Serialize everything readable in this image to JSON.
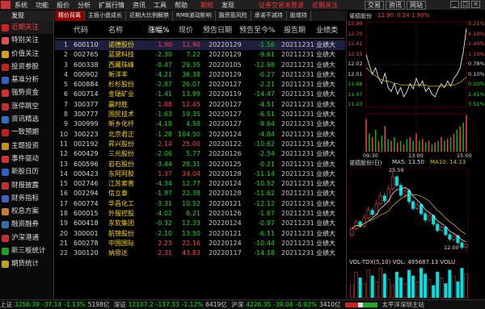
{
  "menu": {
    "items": [
      "系统",
      "功能",
      "报价",
      "分析",
      "扩展行情",
      "资讯",
      "工具",
      "帮助"
    ],
    "period_label": "期权",
    "find_label": "发现",
    "broker_text": "证券交易未登录",
    "follow_text": "近期关注",
    "btn_trade": "交易",
    "btn_info": "资讯",
    "btn_bbs": "网站"
  },
  "window_controls": [
    "_",
    "□",
    "×"
  ],
  "sidebar": {
    "title": "发现",
    "items": [
      {
        "label": "近期关注",
        "color": "#d02020",
        "active": true
      },
      {
        "label": "特别关注",
        "color": "#e05050"
      },
      {
        "label": "价值关注",
        "color": "#d8a020"
      },
      {
        "label": "投资参股",
        "color": "#c02020"
      },
      {
        "label": "基准分析",
        "color": "#3060c0"
      },
      {
        "label": "强势资金",
        "color": "#d03030"
      },
      {
        "label": "涨停跳空",
        "color": "#c03030"
      },
      {
        "label": "资讯精选",
        "color": "#3070c0"
      },
      {
        "label": "一致预期",
        "color": "#c02020"
      },
      {
        "label": "主题投资",
        "color": "#c09020"
      },
      {
        "label": "事件驱动",
        "color": "#d03030"
      },
      {
        "label": "新股日历",
        "color": "#3060c0"
      },
      {
        "label": "财报披露",
        "color": "#c03030"
      },
      {
        "label": "财务指标",
        "color": "#4060c0"
      },
      {
        "label": "权息方案",
        "color": "#c08030"
      },
      {
        "label": "融资融券",
        "color": "#3070b0"
      },
      {
        "label": "沪深港通",
        "color": "#c03030"
      },
      {
        "label": "新三板统计",
        "color": "#20a020"
      },
      {
        "label": "期货统计",
        "color": "#c0a020"
      }
    ]
  },
  "tabs": [
    "精价背离",
    "主板小盘成长",
    "近期大比例解禁",
    "RMB波动影响",
    "融资盈风险",
    "承诺不减持",
    "股增持"
  ],
  "table": {
    "headers": [
      "代码",
      "名称",
      "涨幅%",
      "现价",
      "预告日期",
      "预告至今%",
      "报告期",
      "业绩类"
    ],
    "rows": [
      {
        "idx": "1",
        "code": "600110",
        "name": "诺德股份",
        "pct": "1.90",
        "price": "12.90",
        "date": "20220129",
        "to": "-1.56",
        "report": "20211231",
        "type": "业绩大"
      },
      {
        "idx": "2",
        "code": "002765",
        "name": "蓝黛科技",
        "pct": "-2.30",
        "price": "7.22",
        "date": "20220129",
        "to": "-9.61",
        "report": "20211231",
        "type": "业绩大"
      },
      {
        "idx": "3",
        "code": "600338",
        "name": "西藏珠峰",
        "pct": "-0.47",
        "price": "29.35",
        "date": "20220105",
        "to": "-12.98",
        "report": "20211231",
        "type": "业绩大"
      },
      {
        "idx": "4",
        "code": "000902",
        "name": "新洋丰",
        "pct": "-4.21",
        "price": "36.38",
        "date": "20220129",
        "to": "-0.27",
        "report": "20211231",
        "type": "业绩大"
      },
      {
        "idx": "5",
        "code": "600884",
        "name": "杉杉股份",
        "pct": "-2.87",
        "price": "26.07",
        "date": "20220127",
        "to": "-2.21",
        "report": "20211231",
        "type": "业绩大"
      },
      {
        "idx": "6",
        "code": "600714",
        "name": "金瑞矿业",
        "pct": "-1.41",
        "price": "13.99",
        "date": "20220119",
        "to": "-14.47",
        "report": "20211231",
        "type": "业绩大"
      },
      {
        "idx": "7",
        "code": "300377",
        "name": "赢时胜",
        "pct": "1.88",
        "price": "12.45",
        "date": "20220127",
        "to": "-4.51",
        "report": "20211231",
        "type": "业绩大"
      },
      {
        "idx": "8",
        "code": "300777",
        "name": "国民技术",
        "pct": "-1.63",
        "price": "19.35",
        "date": "20220127",
        "to": "-6.51",
        "report": "20211231",
        "type": "业绩大"
      },
      {
        "idx": "9",
        "code": "300999",
        "name": "新乡化纤",
        "pct": "-4.18",
        "price": "4.58",
        "date": "20220127",
        "to": "-9.64",
        "report": "20211231",
        "type": "业绩大"
      },
      {
        "idx": "10",
        "code": "300223",
        "name": "北京君正",
        "pct": "-1.28",
        "price": "104.50",
        "date": "20220124",
        "to": "-4.84",
        "report": "20211231",
        "type": "业绩大"
      },
      {
        "idx": "11",
        "code": "002192",
        "name": "昇兴股份",
        "pct": "2.14",
        "price": "25.00",
        "date": "20220122",
        "to": "-10.62",
        "report": "20211231",
        "type": "业绩大"
      },
      {
        "idx": "12",
        "code": "600429",
        "name": "三元股份",
        "pct": "-2.06",
        "price": "5.77",
        "date": "20220126",
        "to": "-2.54",
        "report": "20211231",
        "type": "业绩大"
      },
      {
        "idx": "13",
        "code": "600596",
        "name": "岩石股份",
        "pct": "-3.44",
        "price": "28.31",
        "date": "20220125",
        "to": "-0.21",
        "report": "20211231",
        "type": "业绩大"
      },
      {
        "idx": "14",
        "code": "000423",
        "name": "东阿阿胶",
        "pct": "1.37",
        "price": "34.04",
        "date": "20220128",
        "to": "-11.14",
        "report": "20211231",
        "type": "业绩大"
      },
      {
        "idx": "15",
        "code": "002746",
        "name": "江苏索普",
        "pct": "-4.34",
        "price": "12.77",
        "date": "20220124",
        "to": "-10.52",
        "report": "20211231",
        "type": "业绩大"
      },
      {
        "idx": "16",
        "code": "002294",
        "name": "信立泰",
        "pct": "-1.97",
        "price": "22.38",
        "date": "20220128",
        "to": "-11.62",
        "report": "20211231",
        "type": "业绩大"
      },
      {
        "idx": "17",
        "code": "600774",
        "name": "华昌化工",
        "pct": "-3.31",
        "price": "10.52",
        "date": "20220121",
        "to": "-12.12",
        "report": "20211231",
        "type": "业绩大"
      },
      {
        "idx": "18",
        "code": "600015",
        "name": "外服控股",
        "pct": "-4.02",
        "price": "6.21",
        "date": "20220126",
        "to": "-1.67",
        "report": "20211231",
        "type": "业绩大"
      },
      {
        "idx": "19",
        "code": "600418",
        "name": "东软集团",
        "pct": "-0.32",
        "price": "12.33",
        "date": "20220124",
        "to": "-0.97",
        "report": "20211231",
        "type": "业绩大"
      },
      {
        "idx": "20",
        "code": "300001",
        "name": "航锦股份",
        "pct": "-2.10",
        "price": "13.50",
        "date": "20220121",
        "to": "-6.11",
        "report": "20211231",
        "type": "业绩大"
      },
      {
        "idx": "21",
        "code": "600278",
        "name": "中国国际",
        "pct": "2.23",
        "price": "22.16",
        "date": "20220124",
        "to": "-10.44",
        "report": "20211231",
        "type": "业绩大"
      },
      {
        "idx": "22",
        "code": "300120",
        "name": "纳思达",
        "pct": "2.31",
        "price": "43.83",
        "date": "20220117",
        "to": "-14.18",
        "report": "20211231",
        "type": "业绩大"
      }
    ]
  },
  "intraday": {
    "title": "诺德股份",
    "price": "12.90",
    "change": "0.24",
    "pct": "1.90%",
    "left_ticks": [
      "12.90",
      "12.70",
      "12.41",
      "12.15",
      "12.02",
      "12.01",
      "11.66",
      "11.47",
      "11.23"
    ],
    "right_ticks": [
      "5.21%",
      "4.10%",
      "2.44%",
      "1.10%",
      "0.78%",
      "0.10%",
      "0.20%",
      "2.41%",
      "3.51%"
    ],
    "time_ticks": [
      "09:30",
      "13:00",
      "15:00"
    ],
    "prices": [
      12.7,
      12.62,
      12.55,
      12.6,
      12.52,
      12.48,
      12.56,
      12.45,
      12.42,
      12.48,
      12.4,
      12.45,
      12.38,
      12.42,
      12.48,
      12.44,
      12.52,
      12.46,
      12.5,
      12.42,
      12.45,
      12.4,
      12.38,
      12.44,
      12.48,
      12.45,
      12.5,
      12.46,
      12.52,
      12.55,
      12.6,
      12.72,
      12.9
    ],
    "avg": [
      12.6,
      12.58,
      12.55,
      12.54,
      12.52,
      12.51,
      12.5,
      12.5,
      12.49,
      12.48,
      12.48,
      12.47,
      12.47,
      12.47,
      12.47,
      12.47,
      12.47,
      12.47,
      12.47,
      12.47,
      12.46,
      12.46,
      12.46,
      12.46,
      12.46,
      12.46,
      12.47,
      12.47,
      12.47,
      12.48,
      12.49,
      12.51,
      12.53
    ],
    "volume": [
      0.9,
      0.5,
      0.4,
      0.6,
      0.3,
      0.45,
      0.7,
      0.35,
      0.3,
      0.4,
      0.25,
      0.3,
      0.2,
      0.35,
      0.4,
      0.3,
      0.5,
      0.3,
      0.35,
      0.25,
      0.3,
      0.2,
      0.25,
      0.3,
      0.4,
      0.3,
      0.35,
      0.4,
      0.5,
      0.6,
      0.7,
      0.8,
      1.0
    ]
  },
  "daily": {
    "title": "诺德股份(日)",
    "ma5_label": "MA5: 13.50",
    "ma10_label": "MA10: 14.13",
    "high_label": "25.59",
    "low_label": "12.00",
    "vol_label": "VOL-TDX(5,10) VOL: 495687.13 VOLU",
    "axis_ticks": [
      "2021",
      "11",
      "12",
      "2022"
    ],
    "candles": [
      {
        "o": 14.5,
        "c": 15.6,
        "h": 15.9,
        "l": 14.2
      },
      {
        "o": 15.6,
        "c": 16.8,
        "h": 17.2,
        "l": 15.3
      },
      {
        "o": 16.8,
        "c": 16.0,
        "h": 17.1,
        "l": 15.7
      },
      {
        "o": 16.0,
        "c": 17.5,
        "h": 18.0,
        "l": 15.8
      },
      {
        "o": 17.5,
        "c": 18.8,
        "h": 19.4,
        "l": 17.2
      },
      {
        "o": 18.8,
        "c": 18.1,
        "h": 19.2,
        "l": 17.6
      },
      {
        "o": 18.1,
        "c": 19.9,
        "h": 20.6,
        "l": 17.9
      },
      {
        "o": 19.9,
        "c": 21.3,
        "h": 22.0,
        "l": 19.5
      },
      {
        "o": 21.3,
        "c": 20.4,
        "h": 21.8,
        "l": 19.9
      },
      {
        "o": 20.4,
        "c": 22.5,
        "h": 23.2,
        "l": 20.1
      },
      {
        "o": 22.5,
        "c": 24.6,
        "h": 25.59,
        "l": 22.2
      },
      {
        "o": 24.6,
        "c": 23.1,
        "h": 24.9,
        "l": 22.6
      },
      {
        "o": 23.1,
        "c": 21.4,
        "h": 23.5,
        "l": 21.0
      },
      {
        "o": 21.4,
        "c": 22.2,
        "h": 22.9,
        "l": 20.9
      },
      {
        "o": 22.2,
        "c": 20.3,
        "h": 22.5,
        "l": 19.8
      },
      {
        "o": 20.3,
        "c": 19.1,
        "h": 20.6,
        "l": 18.7
      },
      {
        "o": 19.1,
        "c": 19.8,
        "h": 20.4,
        "l": 18.8
      },
      {
        "o": 19.8,
        "c": 18.2,
        "h": 20.0,
        "l": 17.9
      },
      {
        "o": 18.2,
        "c": 17.1,
        "h": 18.6,
        "l": 16.7
      },
      {
        "o": 17.1,
        "c": 17.9,
        "h": 18.3,
        "l": 16.8
      },
      {
        "o": 17.9,
        "c": 16.4,
        "h": 18.1,
        "l": 16.0
      },
      {
        "o": 16.4,
        "c": 15.3,
        "h": 16.7,
        "l": 15.0
      },
      {
        "o": 15.3,
        "c": 15.9,
        "h": 16.3,
        "l": 15.0
      },
      {
        "o": 15.9,
        "c": 14.6,
        "h": 16.1,
        "l": 14.3
      },
      {
        "o": 14.6,
        "c": 13.8,
        "h": 14.9,
        "l": 13.5
      },
      {
        "o": 13.8,
        "c": 14.4,
        "h": 14.7,
        "l": 13.4
      },
      {
        "o": 14.4,
        "c": 13.2,
        "h": 14.6,
        "l": 12.9
      },
      {
        "o": 13.2,
        "c": 12.4,
        "h": 13.4,
        "l": 12.0
      },
      {
        "o": 12.4,
        "c": 12.9,
        "h": 13.1,
        "l": 12.1
      }
    ]
  },
  "status": {
    "sh_label": "上证",
    "sh_value": "3256.39",
    "sh_change": "-37.14",
    "sh_pct": "-1.13%",
    "sh_amt": "5198亿",
    "sz_label": "深证",
    "sz_value": "12107.2",
    "sz_change": "-137.33",
    "sz_pct": "-1.12%",
    "sz_amt": "6419亿",
    "hs_label": "沪深",
    "hs_value": "4226.35",
    "hs_change": "-39.04",
    "hs_pct": "-0.92%",
    "hs_amt": "3410亿",
    "station": "太平洋深圳主站"
  }
}
